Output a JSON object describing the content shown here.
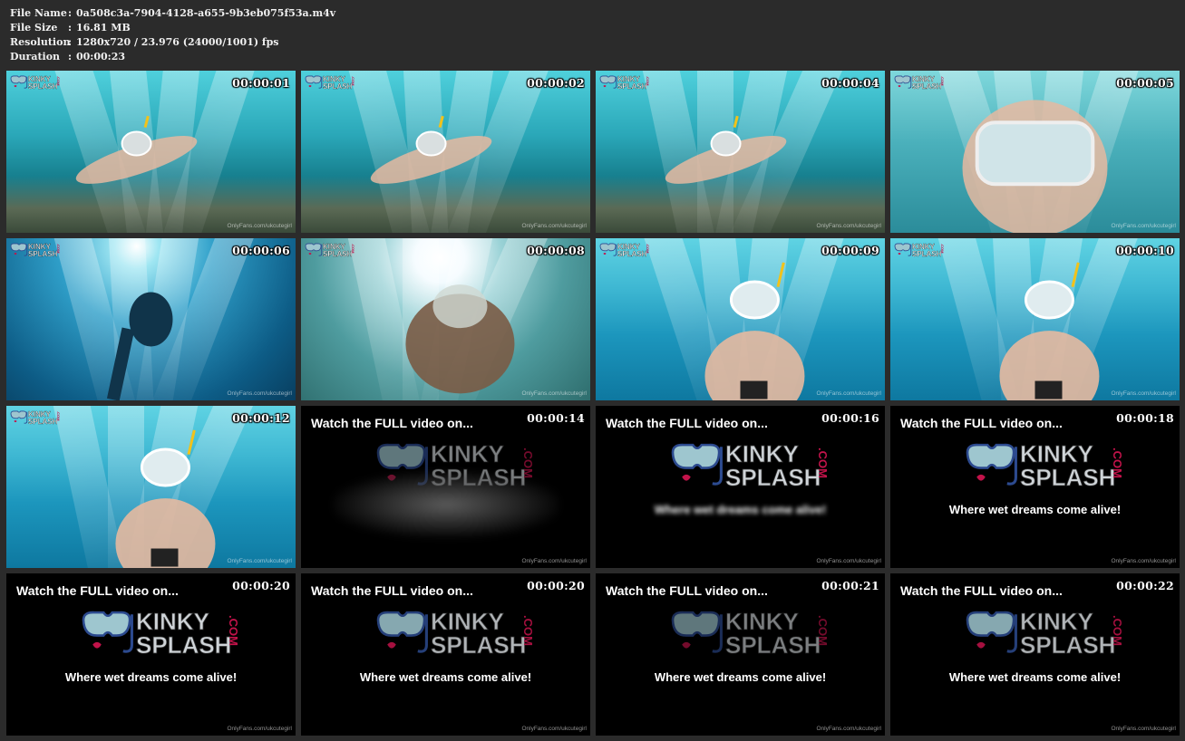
{
  "info": {
    "file_name_label": "File Name",
    "file_name": "0a508c3a-7904-4128-a655-9b3eb075f53a.m4v",
    "file_size_label": "File Size",
    "file_size": "16.81 MB",
    "resolution_label": "Resolution",
    "resolution": "1280x720 / 23.976 (24000/1001) fps",
    "duration_label": "Duration",
    "duration": "00:00:23",
    "separator": ":"
  },
  "logo_small": {
    "line1": "KINKY",
    "line2": "SPLASH",
    "suffix": ".COM"
  },
  "logo_big": {
    "line1": "KINKY",
    "line2": "SPLASH",
    "suffix": ".COM"
  },
  "watch_text": "Watch the FULL video on...",
  "tagline": "Where wet dreams come alive!",
  "watermark": "OnlyFans.com/ukcutegirl",
  "colors": {
    "background": "#2b2b2b",
    "water_light": "#3fc6d6",
    "water_dark": "#0a5d73",
    "logo_red": "#c2134a",
    "logo_gray": "#cfd4d8"
  },
  "thumbs": [
    {
      "time": "00:00:01",
      "kind": "underwater",
      "scene": "seafloor"
    },
    {
      "time": "00:00:02",
      "kind": "underwater",
      "scene": "seafloor"
    },
    {
      "time": "00:00:04",
      "kind": "underwater",
      "scene": "seafloor"
    },
    {
      "time": "00:00:05",
      "kind": "underwater",
      "scene": "closeup"
    },
    {
      "time": "00:00:06",
      "kind": "underwater",
      "scene": "sun"
    },
    {
      "time": "00:00:08",
      "kind": "underwater",
      "scene": "sunburst"
    },
    {
      "time": "00:00:09",
      "kind": "underwater",
      "scene": "surface"
    },
    {
      "time": "00:00:10",
      "kind": "underwater",
      "scene": "surface"
    },
    {
      "time": "00:00:12",
      "kind": "underwater",
      "scene": "surface"
    },
    {
      "time": "00:00:14",
      "kind": "end",
      "logo": "dim",
      "tag": "blob"
    },
    {
      "time": "00:00:16",
      "kind": "end",
      "logo": "full",
      "tag": "blur"
    },
    {
      "time": "00:00:18",
      "kind": "end",
      "logo": "full",
      "tag": "clear"
    },
    {
      "time": "00:00:20",
      "kind": "end",
      "logo": "full",
      "tag": "clear"
    },
    {
      "time": "00:00:20",
      "kind": "end",
      "logo": "mid",
      "tag": "clear"
    },
    {
      "time": "00:00:21",
      "kind": "end",
      "logo": "dim",
      "tag": "clear"
    },
    {
      "time": "00:00:22",
      "kind": "end",
      "logo": "mid",
      "tag": "clear"
    }
  ]
}
